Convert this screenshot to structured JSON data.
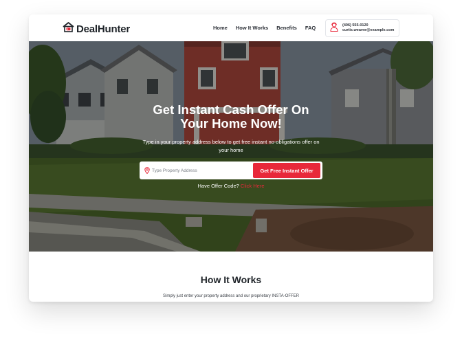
{
  "brand": {
    "name": "DealHunter"
  },
  "nav": {
    "items": [
      {
        "label": "Home"
      },
      {
        "label": "How It Works"
      },
      {
        "label": "Benefits"
      },
      {
        "label": "FAQ"
      }
    ]
  },
  "contact": {
    "phone": "(406) 555-0120",
    "email": "curtis.weaver@example.com"
  },
  "hero": {
    "title_line1": "Get Instant Cash Offer On",
    "title_line2": "Your Home Now!",
    "subtitle": "Type in your property address below to get free instant no-obligations offer on your home",
    "search_placeholder": "Type Property Address",
    "offer_button": "Get Free Instant Offer",
    "offer_code_prefix": "Have Offer Code?",
    "offer_code_link": "Click Here"
  },
  "how_it_works": {
    "title": "How It Works",
    "text": "Simply just enter your property address and our proprietary INSTA-OFFER"
  },
  "colors": {
    "accent": "#e8283a",
    "text_dark": "#1e2328"
  },
  "icons": {
    "logo": "house-tag-icon",
    "contact": "person-headset-icon",
    "search": "location-pin-icon"
  }
}
